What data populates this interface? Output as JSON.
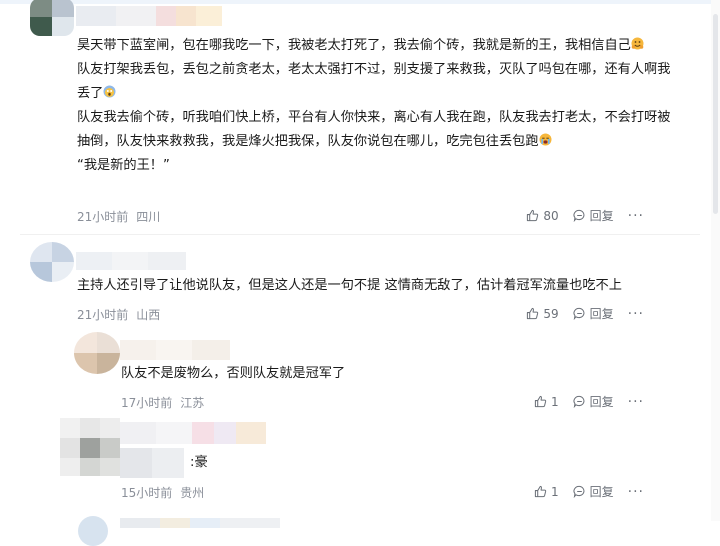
{
  "comments": [
    {
      "paragraphs": [
        "昊天带下蓝室闸，包在哪我吃一下，我被老太打死了，我去偷个砖，我就是新的王，我相信自己",
        "队友打架我丢包，丢包之前贪老太，老太太强打不过，别支援了来救我，灭队了吗包在哪，还有人啊我丢了",
        "队友我去偷个砖，听我咱们快上桥，平台有人你快来，离心有人我在跑，队友我去打老太，不会打呀被抽倒，队友快来救救我，我是烽火把我保，队友你说包在哪儿，吃完包往丢包跑",
        "“我是新的王！”"
      ],
      "time": "21小时前",
      "location": "四川",
      "likes": "80",
      "reply_label": "回复"
    },
    {
      "paragraphs": [
        "主持人还引导了让他说队友，但是这人还是一句不提 这情商无敌了，估计着冠军流量也吃不上"
      ],
      "time": "21小时前",
      "location": "山西",
      "likes": "59",
      "reply_label": "回复"
    }
  ],
  "replies": [
    {
      "text": "队友不是废物么，否则队友就是冠军了",
      "time": "17小时前",
      "location": "江苏",
      "likes": "1",
      "reply_label": "回复"
    },
    {
      "text": ":豪",
      "time": "15小时前",
      "location": "贵州",
      "likes": "1",
      "reply_label": "回复"
    }
  ],
  "colors": {
    "text": "#1a1a1a",
    "meta": "#8a8f99",
    "action": "#6b7078"
  }
}
